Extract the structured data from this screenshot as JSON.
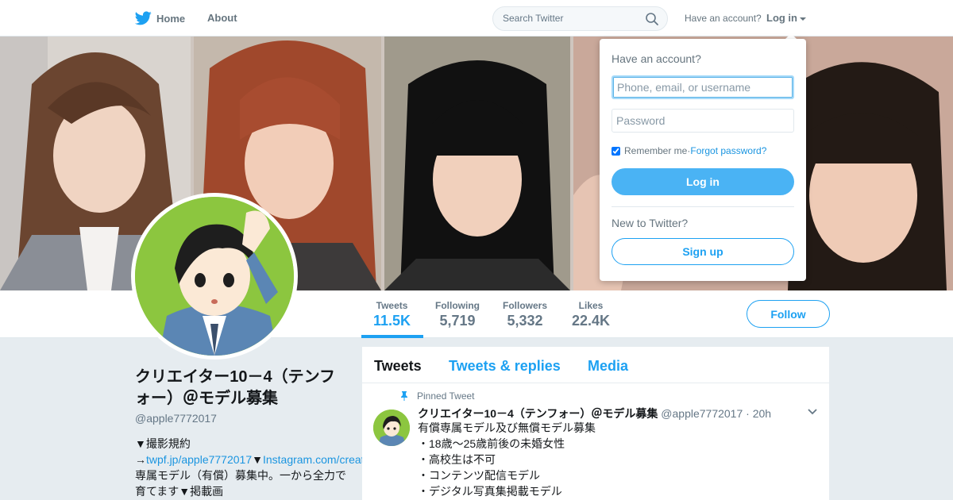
{
  "nav": {
    "home_label": "Home",
    "about_label": "About",
    "search_placeholder": "Search Twitter",
    "have_account": "Have an account?",
    "login_label": "Log in"
  },
  "colors": {
    "accent": "#1da1f2",
    "login_button": "#4ab3f4",
    "avatar_bg": "#8cc63f"
  },
  "stats": [
    {
      "label": "Tweets",
      "value": "11.5K"
    },
    {
      "label": "Following",
      "value": "5,719"
    },
    {
      "label": "Followers",
      "value": "5,332"
    },
    {
      "label": "Likes",
      "value": "22.4K"
    }
  ],
  "follow_label": "Follow",
  "profile": {
    "name": "クリエイター10－4（テンフォー）＠モデル募集",
    "handle": "@apple7772017",
    "bio": {
      "line1": "▼撮影規約",
      "arrow": "→",
      "link1": "twpf.jp/apple7772017",
      "sep": "▼",
      "link2": "Instagram.com/creatortenfour",
      "rest": "▼専属モデル（有償）募集中。一から全力で育てます▼掲載画"
    }
  },
  "timeline": {
    "tabs": [
      "Tweets",
      "Tweets & replies",
      "Media"
    ],
    "pinned_label": "Pinned Tweet",
    "tweet": {
      "name": "クリエイター10－4（テンフォー）＠モデル募集",
      "handle": "@apple7772017",
      "time": "· 20h",
      "lines": [
        "有償専属モデル及び無償モデル募集",
        "・18歳〜25歳前後の未婚女性",
        "・高校生は不可",
        "・コンテンツ配信モデル",
        "・デジタル写真集掲載モデル"
      ]
    }
  },
  "login_dropdown": {
    "title": "Have an account?",
    "username_placeholder": "Phone, email, or username",
    "password_placeholder": "Password",
    "remember_label": "Remember me",
    "separator": " · ",
    "forgot_label": "Forgot password?",
    "login_button": "Log in",
    "new_label": "New to Twitter?",
    "signup_button": "Sign up"
  }
}
